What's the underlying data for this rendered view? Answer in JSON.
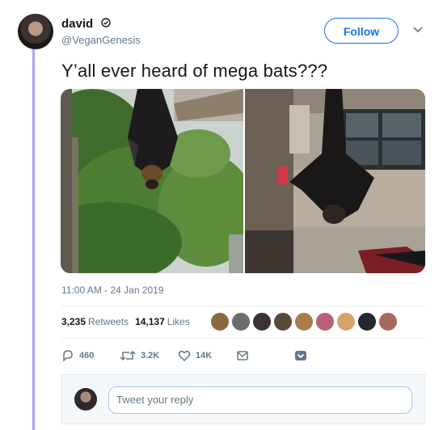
{
  "user": {
    "name": "david",
    "handle": "@VeganGenesis"
  },
  "follow_label": "Follow",
  "tweet_text": "Y’all ever heard of mega bats???",
  "timestamp": "11:00 AM - 24 Jan 2019",
  "stats": {
    "retweets_count": "3,235",
    "retweets_label": "Retweets",
    "likes_count": "14,137",
    "likes_label": "Likes"
  },
  "actions": {
    "replies": "460",
    "retweets": "3.2K",
    "likes": "14K"
  },
  "reply_placeholder": "Tweet your reply",
  "icons": [
    "verified-icon",
    "caret-down-icon",
    "reply-icon",
    "retweet-icon",
    "like-icon",
    "message-icon",
    "dropdown-icon"
  ],
  "colors": {
    "accent": "#1b74e4",
    "thread_line": "#a8a6f2",
    "muted": "#657786"
  }
}
